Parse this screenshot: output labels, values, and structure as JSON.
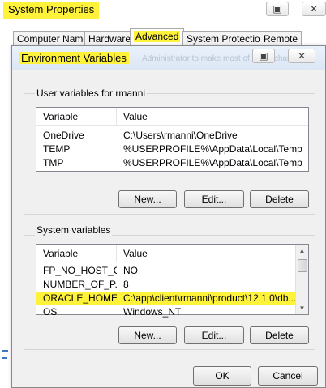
{
  "system_properties": {
    "title": "System Properties",
    "tabs": [
      {
        "label": "Computer Name"
      },
      {
        "label": "Hardware"
      },
      {
        "label": "Advanced",
        "active": true
      },
      {
        "label": "System Protection"
      },
      {
        "label": "Remote"
      }
    ]
  },
  "env_dialog": {
    "title": "Environment Variables",
    "ghost_text": "Administrator to make most of these changes",
    "user_group": {
      "label": "User variables for rmanni",
      "columns": [
        "Variable",
        "Value"
      ],
      "rows": [
        {
          "variable": "OneDrive",
          "value": "C:\\Users\\rmanni\\OneDrive"
        },
        {
          "variable": "TEMP",
          "value": "%USERPROFILE%\\AppData\\Local\\Temp"
        },
        {
          "variable": "TMP",
          "value": "%USERPROFILE%\\AppData\\Local\\Temp"
        }
      ],
      "buttons": {
        "new": "New...",
        "edit": "Edit...",
        "delete": "Delete"
      }
    },
    "system_group": {
      "label": "System variables",
      "columns": [
        "Variable",
        "Value"
      ],
      "rows": [
        {
          "variable": "FP_NO_HOST_C...",
          "value": "NO"
        },
        {
          "variable": "NUMBER_OF_P...",
          "value": "8"
        },
        {
          "variable": "ORACLE_HOME",
          "value": "C:\\app\\client\\rmanni\\product\\12.1.0\\db..."
        },
        {
          "variable": "OS",
          "value": "Windows_NT"
        }
      ],
      "buttons": {
        "new": "New...",
        "edit": "Edit...",
        "delete": "Delete"
      }
    },
    "ok_label": "OK",
    "cancel_label": "Cancel"
  },
  "colors": {
    "highlight": "#fff23a",
    "dialog_bg": "#f0f0f0"
  }
}
